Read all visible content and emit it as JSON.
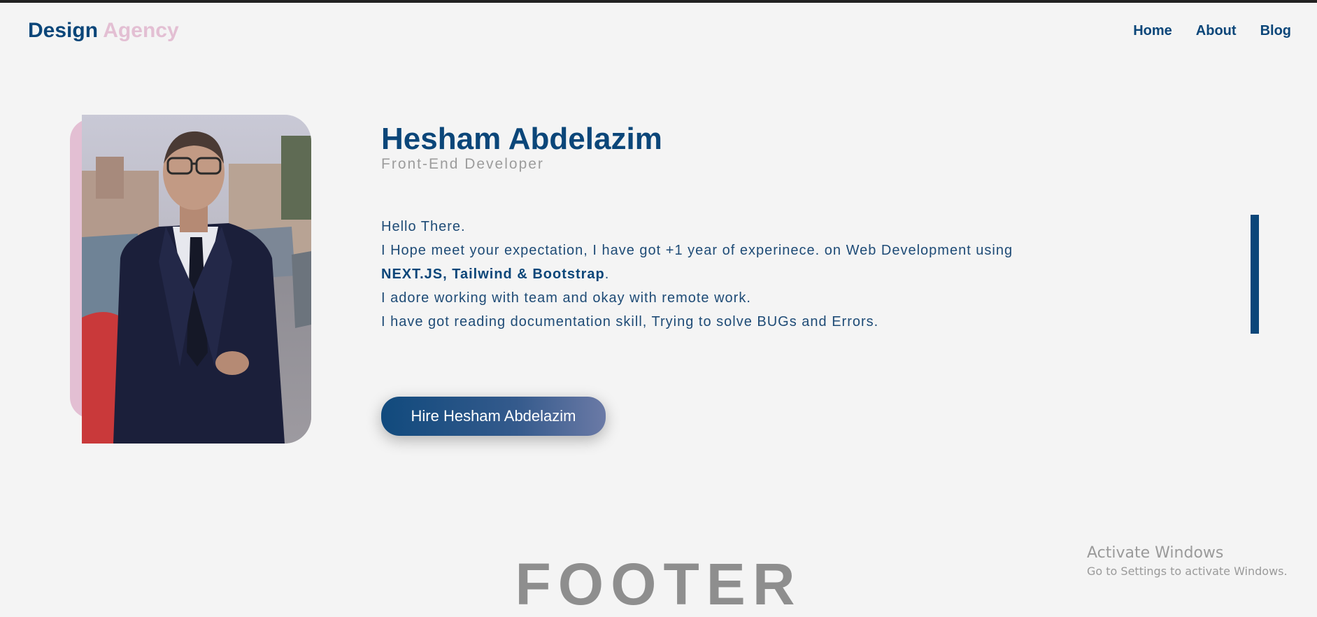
{
  "header": {
    "logo_part1": "Design",
    "logo_part2": "Agency",
    "nav": [
      "Home",
      "About",
      "Blog"
    ]
  },
  "profile": {
    "name": "Hesham Abdelazim",
    "role": "Front-End Developer",
    "bio": {
      "line1": "Hello There.",
      "line2": "I Hope meet your expectation, I have got +1 year of experinece. on Web Development using",
      "line3_tech": "NEXT.JS, Tailwind & Bootstrap",
      "line3_end": ".",
      "line4": "I adore working with team and okay with remote work.",
      "line5": "I have got reading documentation skill, Trying to solve BUGs and Errors."
    },
    "hire_button": "Hire Hesham Abdelazim"
  },
  "footer": {
    "title": "FOOTER"
  },
  "watermark": {
    "title": "Activate Windows",
    "subtitle": "Go to Settings to activate Windows."
  },
  "colors": {
    "primary": "#0b4679",
    "accent_pink": "#e3bfd3",
    "background": "#f4f4f4",
    "muted": "#9c9c9c"
  }
}
